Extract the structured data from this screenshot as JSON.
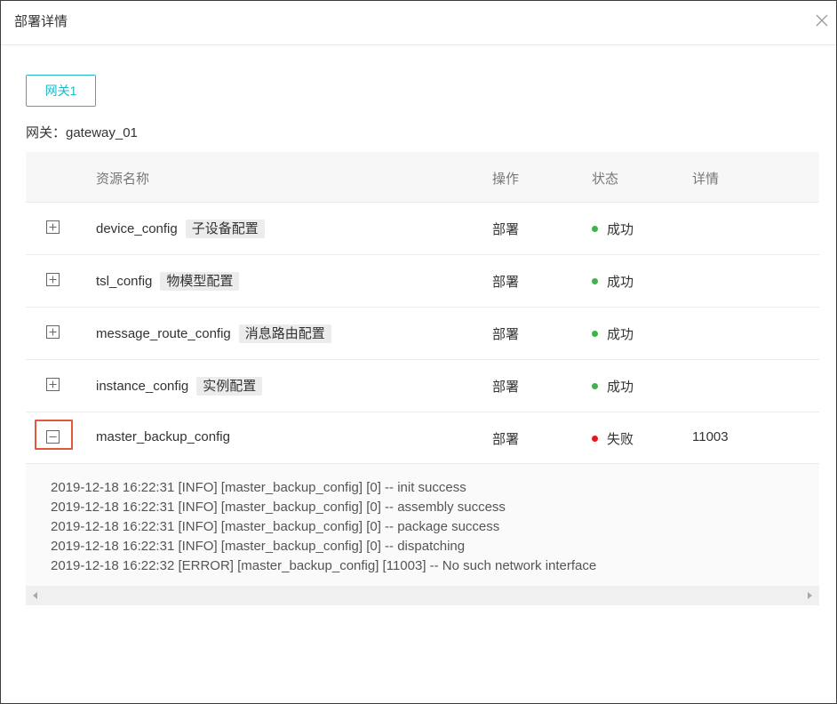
{
  "dialog": {
    "title": "部署详情"
  },
  "tab": {
    "label": "网关1"
  },
  "gateway_line": "网关：gateway_01",
  "table": {
    "columns": {
      "name": "资源名称",
      "op": "操作",
      "status": "状态",
      "detail": "详情"
    },
    "rows": [
      {
        "name": "device_config",
        "tag": "子设备配置",
        "op": "部署",
        "status": "成功",
        "detail": ""
      },
      {
        "name": "tsl_config",
        "tag": "物模型配置",
        "op": "部署",
        "status": "成功",
        "detail": ""
      },
      {
        "name": "message_route_config",
        "tag": "消息路由配置",
        "op": "部署",
        "status": "成功",
        "detail": ""
      },
      {
        "name": "instance_config",
        "tag": "实例配置",
        "op": "部署",
        "status": "成功",
        "detail": ""
      },
      {
        "name": "master_backup_config",
        "tag": "",
        "op": "部署",
        "status": "失败",
        "detail": "11003"
      }
    ]
  },
  "log": [
    "2019-12-18 16:22:31 [INFO] [master_backup_config] [0] -- init success",
    "2019-12-18 16:22:31 [INFO] [master_backup_config] [0] -- assembly success",
    "2019-12-18 16:22:31 [INFO] [master_backup_config] [0] -- package success",
    "2019-12-18 16:22:31 [INFO] [master_backup_config] [0] -- dispatching",
    "2019-12-18 16:22:32 [ERROR] [master_backup_config] [11003] -- No such network interface"
  ],
  "colors": {
    "accent": "#1fb8c8",
    "success": "#3cb44b",
    "fail": "#e8141e",
    "highlight": "#e05a3a"
  },
  "icons": {
    "close": "close-icon",
    "expand": "plus-square-icon",
    "collapse": "minus-square-icon"
  }
}
